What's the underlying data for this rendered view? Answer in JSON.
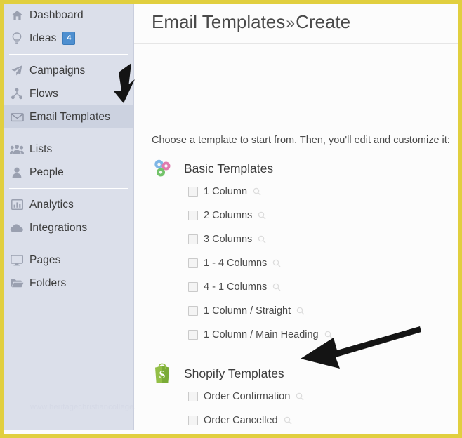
{
  "window": {
    "border_color": "#e1cf3f",
    "background": "#fcfcfc"
  },
  "sidebar": {
    "background": "#dbdfea",
    "active_background": "#ccd2e0",
    "watermark": "www.heritagechristiancollege.com",
    "groups": [
      {
        "items": [
          {
            "label": "Dashboard",
            "icon": "home-icon",
            "active": false
          },
          {
            "label": "Ideas",
            "icon": "lightbulb-icon",
            "active": false,
            "badge": "4"
          }
        ]
      },
      {
        "items": [
          {
            "label": "Campaigns",
            "icon": "paper-plane-icon",
            "active": false
          },
          {
            "label": "Flows",
            "icon": "flow-nodes-icon",
            "active": false
          },
          {
            "label": "Email Templates",
            "icon": "envelope-icon",
            "active": true
          }
        ]
      },
      {
        "items": [
          {
            "label": "Lists",
            "icon": "users-group-icon",
            "active": false
          },
          {
            "label": "People",
            "icon": "person-icon",
            "active": false
          }
        ]
      },
      {
        "items": [
          {
            "label": "Analytics",
            "icon": "bar-chart-icon",
            "active": false
          },
          {
            "label": "Integrations",
            "icon": "cloud-icon",
            "active": false
          }
        ]
      },
      {
        "items": [
          {
            "label": "Pages",
            "icon": "monitor-icon",
            "active": false
          },
          {
            "label": "Folders",
            "icon": "folder-icon",
            "active": false
          }
        ]
      }
    ]
  },
  "header": {
    "title_primary": "Email Templates",
    "separator": "»",
    "title_secondary": "Create"
  },
  "main": {
    "intro": "Choose a template to start from. Then, you'll edit and customize it:",
    "groups": [
      {
        "title": "Basic Templates",
        "icon": "gears-icon",
        "templates": [
          {
            "label": "1 Column",
            "checked": false,
            "zoom_icon": "magnifier-icon"
          },
          {
            "label": "2 Columns",
            "checked": false,
            "zoom_icon": "magnifier-icon"
          },
          {
            "label": "3 Columns",
            "checked": false,
            "zoom_icon": "magnifier-icon"
          },
          {
            "label": "1 - 4 Columns",
            "checked": false,
            "zoom_icon": "magnifier-icon"
          },
          {
            "label": "4 - 1 Columns",
            "checked": false,
            "zoom_icon": "magnifier-icon"
          },
          {
            "label": "1 Column / Straight",
            "checked": false,
            "zoom_icon": "magnifier-icon"
          },
          {
            "label": "1 Column / Main Heading",
            "checked": false,
            "zoom_icon": "magnifier-icon"
          }
        ]
      },
      {
        "title": "Shopify Templates",
        "icon": "shopify-bag-icon",
        "templates": [
          {
            "label": "Order Confirmation",
            "checked": false,
            "zoom_icon": "magnifier-icon"
          },
          {
            "label": "Order Cancelled",
            "checked": false,
            "zoom_icon": "magnifier-icon"
          }
        ]
      }
    ]
  },
  "annotations": [
    {
      "name": "sidebar-callout-arrow",
      "direction": "down-left",
      "color": "#111111"
    },
    {
      "name": "shopify-callout-arrow",
      "direction": "left",
      "color": "#111111"
    }
  ]
}
